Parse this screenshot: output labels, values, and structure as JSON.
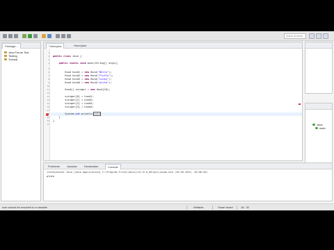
{
  "toolbar": {
    "quick_access_placeholder": "Quick Access"
  },
  "package_explorer": {
    "tab_label": "Package...",
    "items": [
      {
        "label": "Java Forum Test"
      },
      {
        "label": "Testing"
      },
      {
        "label": "Tutorial"
      }
    ]
  },
  "editor": {
    "tabs": [
      {
        "label": "*Java.java",
        "active": true
      },
      {
        "label": "Hund.java",
        "active": false
      }
    ],
    "lines": [
      {
        "num": "1",
        "text": ""
      },
      {
        "num": "2",
        "text": "public class Java {"
      },
      {
        "num": "3",
        "text": ""
      },
      {
        "num": "4",
        "text": "    public static void main(String[] args){"
      },
      {
        "num": "5",
        "text": ""
      },
      {
        "num": "6",
        "text": "        Hund hund1 = new Hund(\"Bello\");"
      },
      {
        "num": "7",
        "text": "        Hund hund2 = new Hund(\"Fluffy\");"
      },
      {
        "num": "8",
        "text": "        Hund hund3 = new Hund(\"Lucky\");"
      },
      {
        "num": "9",
        "text": "        Hund hund4 = new Hund(\"pluto\");"
      },
      {
        "num": "10",
        "text": ""
      },
      {
        "num": "11",
        "text": "        Hund[] svinger = new Hund[10];"
      },
      {
        "num": "12",
        "text": ""
      },
      {
        "num": "13",
        "text": "        svinger[0] = hund1;"
      },
      {
        "num": "14",
        "text": "        svinger[1] = hund2;"
      },
      {
        "num": "15",
        "text": "        svinger[2] = hund3;"
      },
      {
        "num": "16",
        "text": "        svinger[3] = hund4;"
      },
      {
        "num": "17",
        "text": ""
      },
      {
        "num": "18",
        "text": "        System.out.println(svin"
      },
      {
        "num": "19",
        "text": "    }"
      },
      {
        "num": "20",
        "text": "}"
      },
      {
        "num": "21",
        "text": ""
      }
    ],
    "error_completion": "svin"
  },
  "bottom_panel": {
    "tabs": [
      {
        "label": "Problems",
        "active": false
      },
      {
        "label": "Javadoc",
        "active": false
      },
      {
        "label": "Declaration",
        "active": false
      },
      {
        "label": "Console",
        "active": true
      }
    ],
    "console_header": "<terminated> Java [Java Application] C:\\Program Files\\Java\\jre1.8.0_60\\bin\\javaw.exe (20.09.2015, 20:06:26)",
    "console_output": "pluto"
  },
  "outline": {
    "items": [
      {
        "label": "Java"
      },
      {
        "label": "main"
      }
    ]
  },
  "status_bar": {
    "message": "svin cannot be resolved to a variable",
    "mode": "Writable",
    "insert": "Smart Insert",
    "position": "18 : 32"
  }
}
